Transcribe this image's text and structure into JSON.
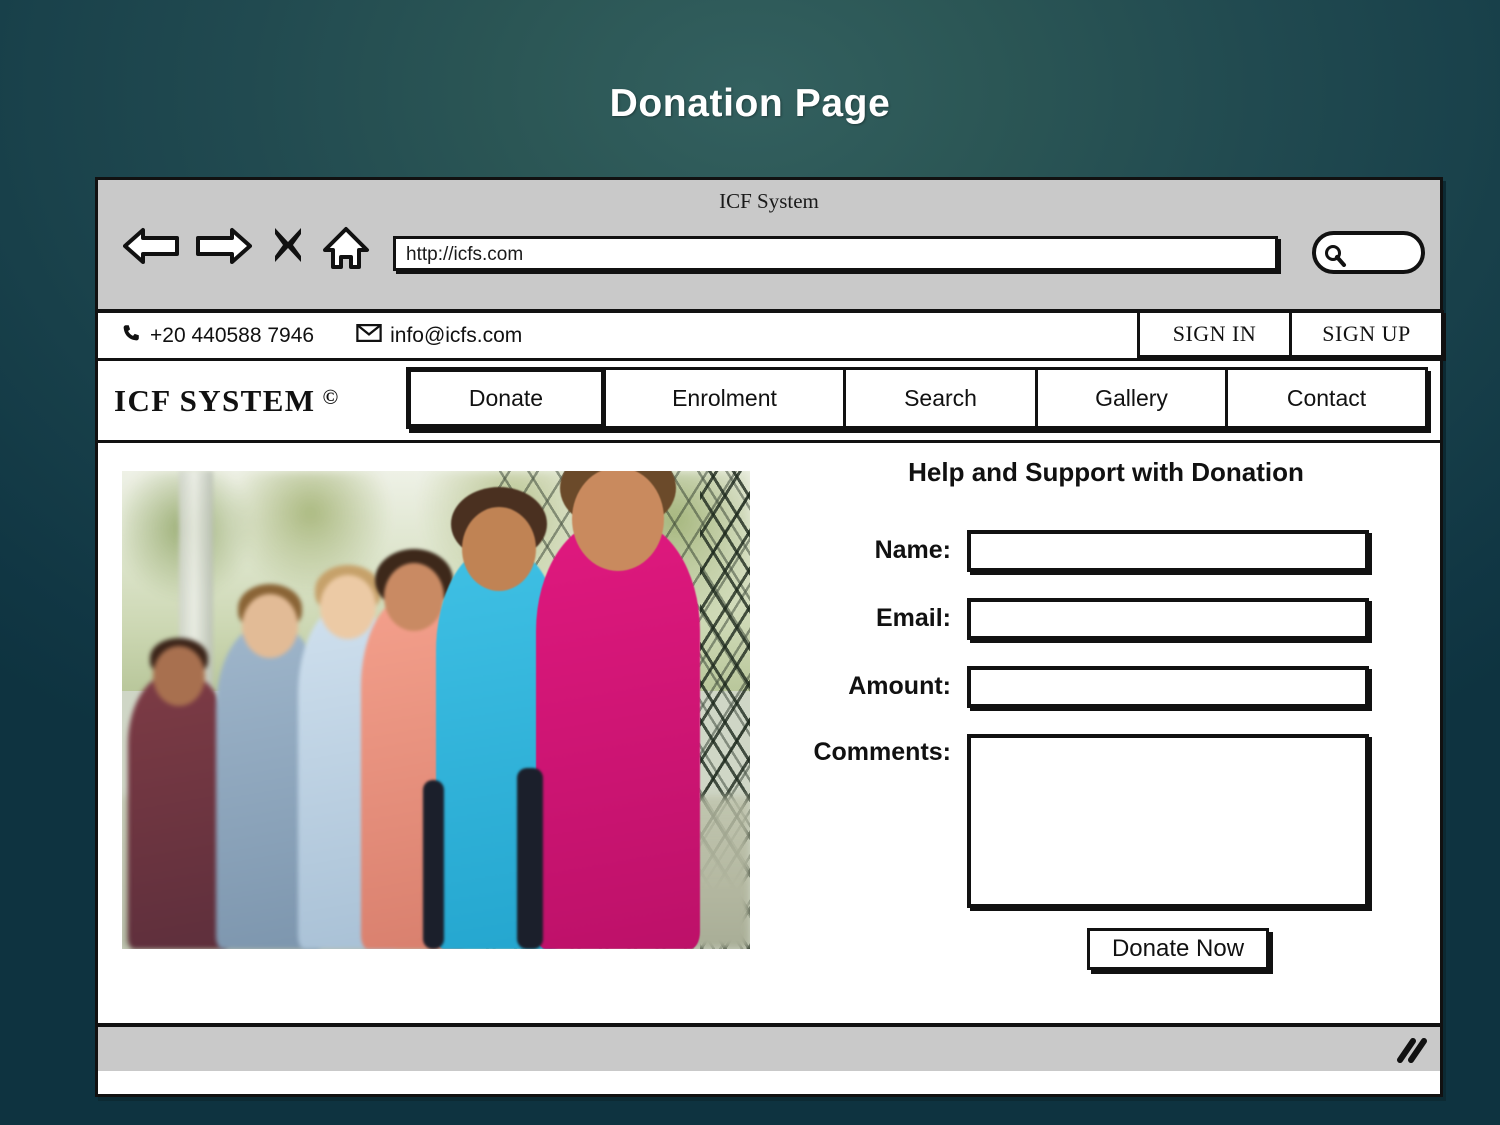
{
  "slide": {
    "title": "Donation Page"
  },
  "browser": {
    "document_title": "ICF System",
    "url_value": "http://icfs.com",
    "url_placeholder": "http://",
    "search_value": "",
    "search_placeholder": "",
    "toolbar_icons": [
      {
        "name": "back-arrow-icon",
        "glyph": "back"
      },
      {
        "name": "forward-arrow-icon",
        "glyph": "forward"
      },
      {
        "name": "stop-close-icon",
        "glyph": "X"
      },
      {
        "name": "home-icon",
        "glyph": "home"
      }
    ],
    "search_icon": "search-icon",
    "resize_grip_icon": "resize-grip-icon"
  },
  "contact_bar": {
    "phone_icon": "phone-icon",
    "phone": "+20 440588 7946",
    "email_icon": "envelope-icon",
    "email": "info@icfs.com",
    "sign_in_label": "SIGN IN",
    "sign_up_label": "SIGN UP"
  },
  "site_header": {
    "logo_text": "ICF SYSTEM",
    "logo_copyright": "©",
    "nav_items": [
      {
        "label": "Donate",
        "active": true
      },
      {
        "label": "Enrolment",
        "active": false
      },
      {
        "label": "Search",
        "active": false
      },
      {
        "label": "Gallery",
        "active": false
      },
      {
        "label": "Contact",
        "active": false
      }
    ]
  },
  "hero": {
    "image_alt": "Group of smiling schoolchildren standing beside a chain-link fence"
  },
  "form": {
    "heading": "Help and Support with Donation",
    "fields": [
      {
        "label": "Name:",
        "value": "",
        "placeholder": "",
        "type": "text"
      },
      {
        "label": "Email:",
        "value": "",
        "placeholder": "",
        "type": "text"
      },
      {
        "label": "Amount:",
        "value": "",
        "placeholder": "",
        "type": "text"
      },
      {
        "label": "Comments:",
        "value": "",
        "placeholder": "",
        "type": "textarea"
      }
    ],
    "submit_label": "Donate Now"
  },
  "colors": {
    "background_outer": "#0e3340",
    "background_inner": "#33605f",
    "chrome_gray": "#c9c9c9",
    "ink": "#111111",
    "paper": "#ffffff"
  }
}
